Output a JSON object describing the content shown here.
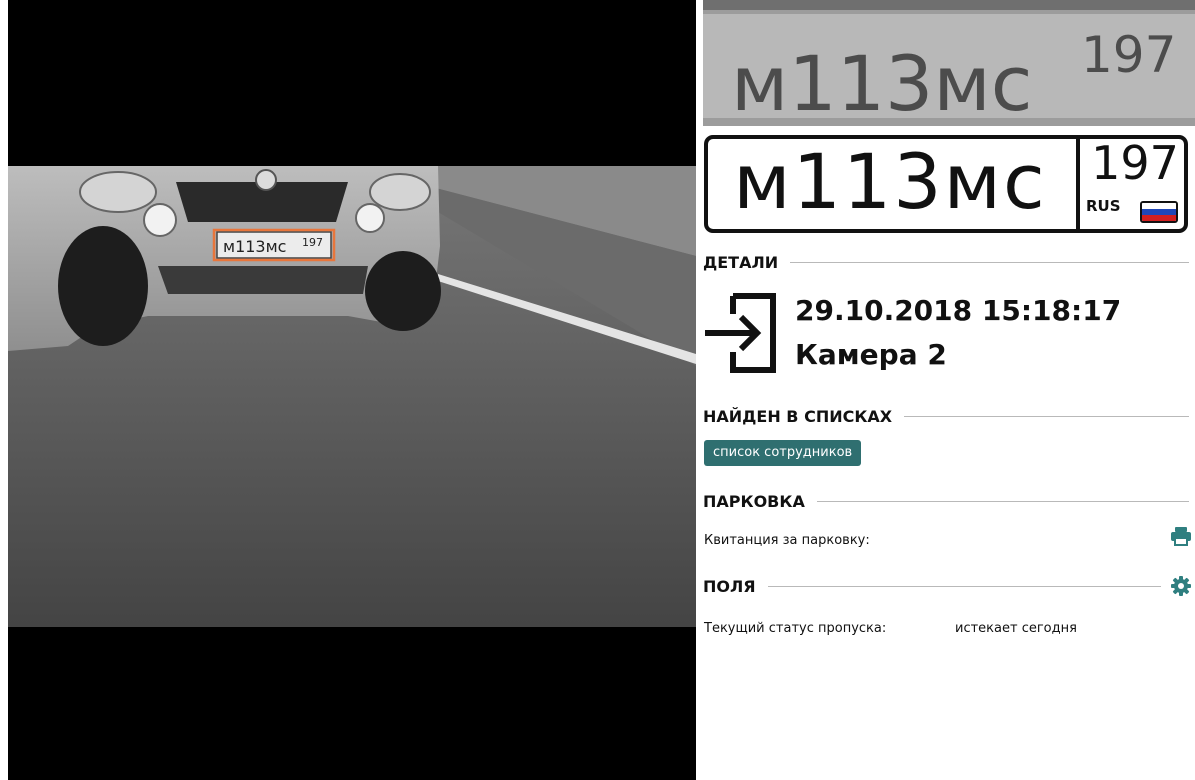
{
  "camera": {
    "plate_text": "м113мс",
    "plate_region": "197"
  },
  "plate_crop": {
    "text": "м113мс",
    "region": "197"
  },
  "plate": {
    "number": "м113мс",
    "region": "197",
    "country": "RUS"
  },
  "details": {
    "title": "ДЕТАЛИ",
    "datetime": "29.10.2018 15:18:17",
    "camera": "Камера 2"
  },
  "lists": {
    "title": "НАЙДЕН В СПИСКАХ",
    "tags": [
      "список сотрудников"
    ]
  },
  "parking": {
    "title": "ПАРКОВКА",
    "receipt_label": "Квитанция за парковку:"
  },
  "fields": {
    "title": "ПОЛЯ",
    "items": [
      {
        "label": "Текущий статус пропуска:",
        "value": "истекает сегодня"
      }
    ]
  },
  "colors": {
    "accent": "#2f7f80",
    "tag_bg": "#2f6f70",
    "highlight_box": "#e8763c",
    "flag_white": "#ffffff",
    "flag_blue": "#1f47b8",
    "flag_red": "#d11f1f"
  },
  "icons": {
    "entry": "entry-arrow-icon",
    "print": "printer-icon",
    "settings": "gear-icon"
  }
}
